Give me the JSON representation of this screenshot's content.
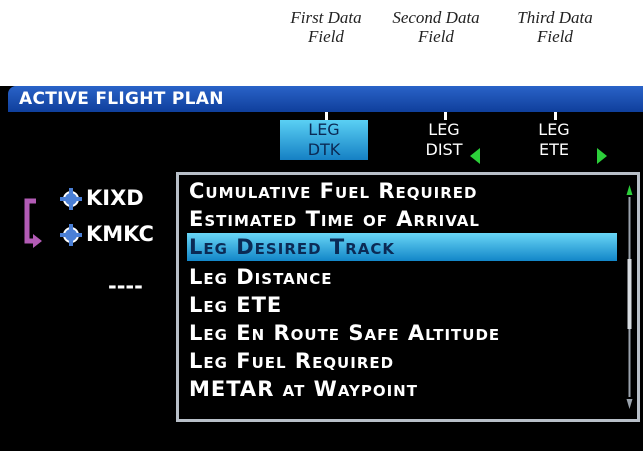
{
  "callouts": {
    "first": [
      "First Data",
      "Field"
    ],
    "second": [
      "Second Data",
      "Field"
    ],
    "third": [
      "Third Data",
      "Field"
    ]
  },
  "window": {
    "title": "ACTIVE FLIGHT PLAN"
  },
  "columns": [
    {
      "line1": "LEG",
      "line2": "DTK",
      "selected": true
    },
    {
      "line1": "LEG",
      "line2": "DIST",
      "selected": false
    },
    {
      "line1": "LEG",
      "line2": "ETE",
      "selected": false
    }
  ],
  "flight_plan": [
    {
      "ident": "KIXD"
    },
    {
      "ident": "KMKC"
    },
    {
      "placeholder": "----"
    }
  ],
  "options": [
    "Cumulative Fuel Required",
    "Estimated Time of Arrival",
    "Leg Desired Track",
    "Leg Distance",
    "Leg ETE",
    "Leg En Route Safe Altitude",
    "Leg Fuel Required",
    "METAR at Waypoint"
  ],
  "selected_option_index": 2,
  "colors": {
    "accent": "#1a86c8",
    "arrow": "#2ccf3a",
    "bracket": "#b25bb5",
    "waypoint": "#4a7fd6"
  }
}
